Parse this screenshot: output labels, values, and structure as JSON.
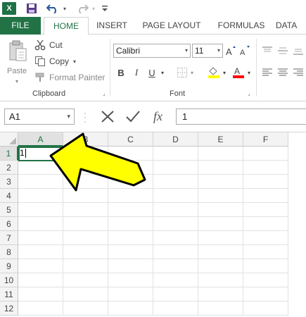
{
  "qat": {
    "logo_text": "X",
    "undo_icon": "undo-icon",
    "redo_icon": "redo-icon"
  },
  "tabs": {
    "file": "FILE",
    "home": "HOME",
    "insert": "INSERT",
    "page_layout": "PAGE LAYOUT",
    "formulas": "FORMULAS",
    "data": "DATA"
  },
  "clipboard": {
    "paste": "Paste",
    "cut": "Cut",
    "copy": "Copy",
    "format_painter": "Format Painter",
    "group_label": "Clipboard"
  },
  "font": {
    "font_name": "Calibri",
    "font_size": "11",
    "group_label": "Font",
    "bold": "B",
    "italic": "I",
    "underline": "U",
    "fill_color": "#ffff00",
    "font_color": "#ff0000"
  },
  "formula_bar": {
    "name_box": "A1",
    "fx_label": "fx",
    "value": "1"
  },
  "grid": {
    "columns": [
      "A",
      "B",
      "C",
      "D",
      "E",
      "F"
    ],
    "rows": [
      "1",
      "2",
      "3",
      "4",
      "5",
      "6",
      "7",
      "8",
      "9",
      "10",
      "11",
      "12"
    ],
    "cell_a1": "1",
    "selected_column": "A",
    "selected_row": "1"
  },
  "colors": {
    "accent": "#217346",
    "arrow_fill": "#ffff00",
    "arrow_stroke": "#000000"
  }
}
